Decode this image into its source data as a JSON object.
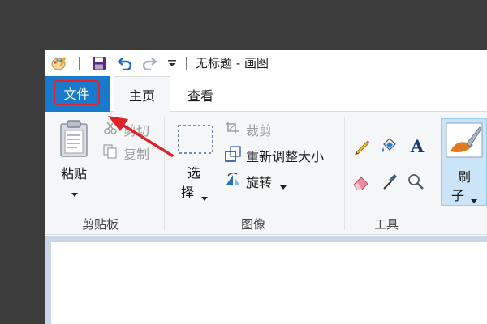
{
  "title_bar": {
    "title": "无标题 - 画图",
    "icons": [
      "paint-app-icon",
      "save-icon",
      "undo-icon",
      "redo-icon",
      "customize-dropdown-icon"
    ]
  },
  "tabs": {
    "file": "文件",
    "home": "主页",
    "view": "查看"
  },
  "clipboard": {
    "paste": "粘贴",
    "cut": "剪切",
    "copy": "复制",
    "group": "剪贴板"
  },
  "image": {
    "select_line1": "选",
    "select_line2": "择",
    "crop": "裁剪",
    "resize": "重新调整大小",
    "rotate": "旋转",
    "group": "图像"
  },
  "tools": {
    "group": "工具",
    "icons": [
      "pencil-icon",
      "fill-icon",
      "text-icon",
      "eraser-icon",
      "color-picker-icon",
      "magnifier-icon"
    ]
  },
  "brushes": {
    "line1": "刷",
    "line2": "子"
  },
  "colors": {
    "file_tab": "#1979ca",
    "highlight": "#e0222c"
  }
}
